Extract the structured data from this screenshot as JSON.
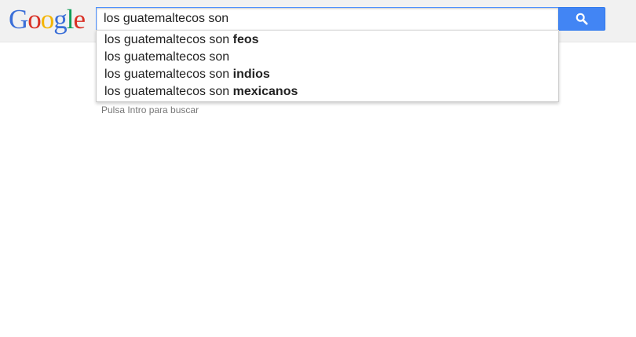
{
  "logo": {
    "letters": [
      {
        "char": "G",
        "color": "#3b6fd8"
      },
      {
        "char": "o",
        "color": "#d93025"
      },
      {
        "char": "o",
        "color": "#f4b400"
      },
      {
        "char": "g",
        "color": "#3b6fd8"
      },
      {
        "char": "l",
        "color": "#0f9d58"
      },
      {
        "char": "e",
        "color": "#d93025"
      }
    ]
  },
  "search": {
    "value": "los guatemaltecos son ",
    "button_icon": "search-icon"
  },
  "suggestions": [
    {
      "prefix": "los guatemaltecos son ",
      "completion": "feos"
    },
    {
      "prefix": "los guatemaltecos son",
      "completion": ""
    },
    {
      "prefix": "los guatemaltecos son ",
      "completion": "indios"
    },
    {
      "prefix": "los guatemaltecos son ",
      "completion": "mexicanos"
    }
  ],
  "hint": "Pulsa Intro para buscar",
  "colors": {
    "topbar_bg": "#f1f1f1",
    "button_bg": "#4285f4",
    "input_border": "#4d90fe",
    "hint_text": "#777777"
  }
}
